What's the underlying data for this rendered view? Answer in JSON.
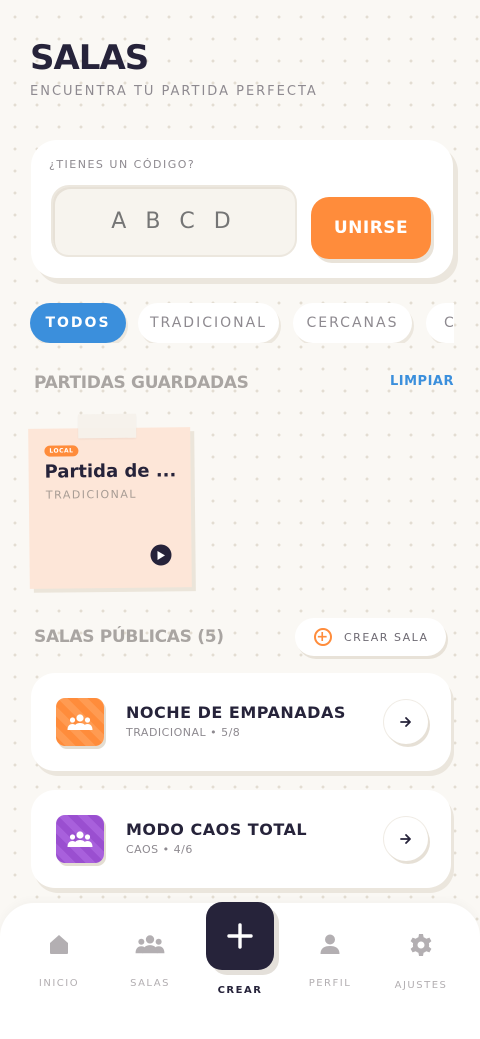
{
  "header": {
    "title": "SALAS",
    "subtitle": "ENCUENTRA TU PARTIDA PERFECTA"
  },
  "code_box": {
    "label": "¿TIENES UN CÓDIGO?",
    "placeholder": "A B C D",
    "value": "",
    "join_label": "UNIRSE"
  },
  "filters": {
    "items": [
      {
        "label": "TODOS",
        "active": true
      },
      {
        "label": "TRADICIONAL",
        "active": false
      },
      {
        "label": "CERCANAS",
        "active": false
      },
      {
        "label": "C",
        "active": false
      }
    ]
  },
  "saved": {
    "title": "PARTIDAS GUARDADAS",
    "clear_label": "LIMPIAR",
    "games": [
      {
        "badge": "LOCAL",
        "name": "Partida de ...",
        "type": "TRADICIONAL"
      }
    ]
  },
  "public": {
    "title": "SALAS PÚBLICAS (5)",
    "create_label": "CREAR SALA",
    "rooms": [
      {
        "name": "NOCHE DE EMPANADAS",
        "meta": "TRADICIONAL • 5/8",
        "color": "#ff8c3b"
      },
      {
        "name": "MODO CAOS TOTAL",
        "meta": "CAOS • 4/6",
        "color": "#9a4fd0"
      }
    ]
  },
  "nav": {
    "items": [
      {
        "label": "INICIO",
        "icon": "home-icon"
      },
      {
        "label": "SALAS",
        "icon": "group-icon"
      },
      {
        "label": "CREAR",
        "icon": "plus-icon"
      },
      {
        "label": "PERFIL",
        "icon": "user-icon"
      },
      {
        "label": "AJUSTES",
        "icon": "gear-icon"
      }
    ]
  },
  "colors": {
    "accent": "#ff8c3b",
    "primary": "#3b8fdc",
    "dark": "#26233a",
    "purple": "#9a4fd0"
  }
}
